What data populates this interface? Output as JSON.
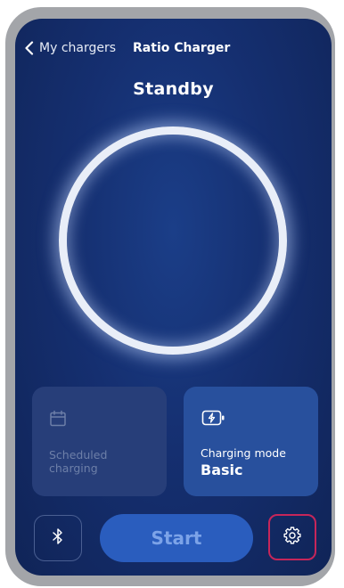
{
  "header": {
    "back_label": "My chargers",
    "title": "Ratio Charger"
  },
  "status": "Standby",
  "cards": {
    "scheduled": {
      "label": "Scheduled charging",
      "icon": "calendar-icon"
    },
    "mode": {
      "label": "Charging mode",
      "value": "Basic",
      "icon": "battery-bolt-icon"
    }
  },
  "actions": {
    "bluetooth_icon": "bluetooth-icon",
    "start_label": "Start",
    "settings_icon": "gear-icon"
  },
  "colors": {
    "background": "#152f70",
    "card_disabled": "#273e79",
    "card_active": "#28509d",
    "start_button": "#2a5dbe",
    "highlight": "#c6265a"
  }
}
